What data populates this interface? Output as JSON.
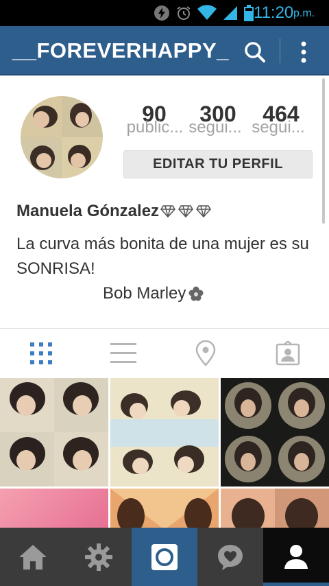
{
  "status_bar": {
    "time": "11:20",
    "ampm": "p.m."
  },
  "action_bar": {
    "username": "__FOREVERHAPPY_",
    "search_icon": "search-icon",
    "more_icon": "more-vertical-icon"
  },
  "profile": {
    "stats": [
      {
        "value": "90",
        "label": "public..."
      },
      {
        "value": "300",
        "label": "segui..."
      },
      {
        "value": "464",
        "label": "segui..."
      }
    ],
    "edit_button": "EDITAR TU PERFIL",
    "full_name": "Manuela Gónzalez",
    "bio": "La curva más bonita de una mujer es su SONRISA!",
    "bio_author": "Bob Marley"
  },
  "view_tabs": [
    {
      "name": "grid-icon",
      "active": true
    },
    {
      "name": "list-icon",
      "active": false
    },
    {
      "name": "location-pin-icon",
      "active": false
    },
    {
      "name": "tagged-photos-icon",
      "active": false
    }
  ],
  "bottom_nav": [
    {
      "name": "home-icon"
    },
    {
      "name": "explore-icon"
    },
    {
      "name": "camera-icon"
    },
    {
      "name": "activity-icon"
    },
    {
      "name": "profile-icon"
    }
  ],
  "colors": {
    "brand_blue": "#2e5e8c",
    "status_blue": "#33b5e5",
    "tab_active": "#3d7dc4",
    "tab_inactive": "#b5b5b5",
    "nav_bg": "#3b3b3b"
  }
}
